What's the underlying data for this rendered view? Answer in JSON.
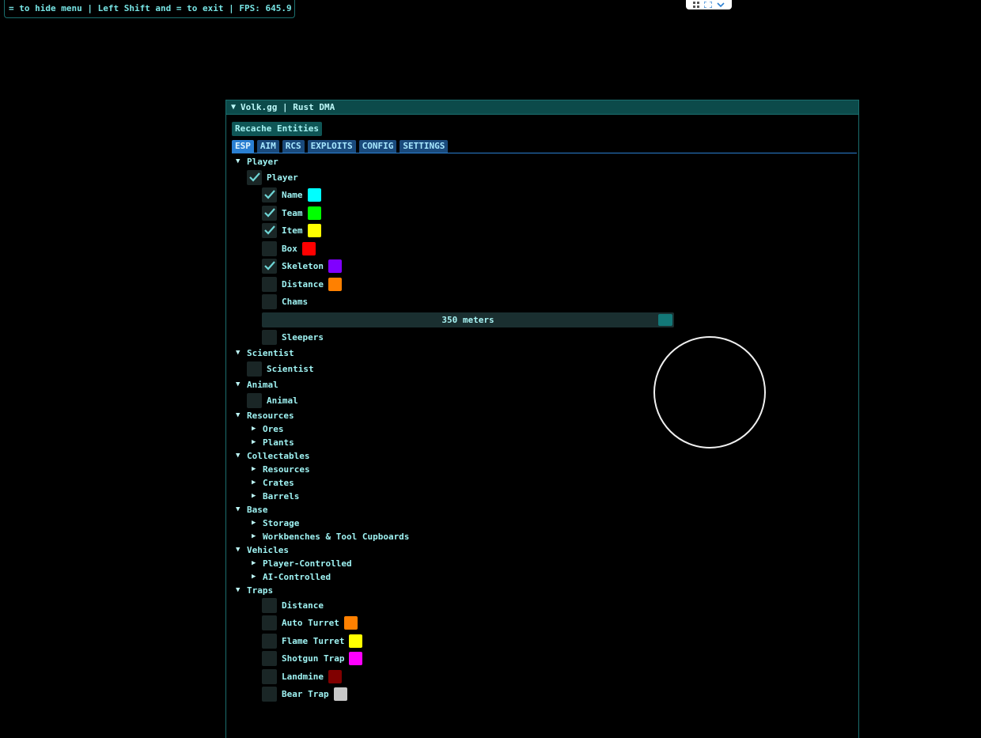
{
  "hint_bar": {
    "text": "= to hide menu | Left Shift and = to exit | FPS: 645.9"
  },
  "window": {
    "title": "Volk.gg | Rust DMA"
  },
  "recache_button": "Recache Entities",
  "tabs": [
    "ESP",
    "AIM",
    "RCS",
    "EXPLOITS",
    "CONFIG",
    "SETTINGS"
  ],
  "active_tab": "ESP",
  "sections": {
    "player": {
      "header": "Player",
      "toggle_label": "Player",
      "toggle_checked": true,
      "options": [
        {
          "label": "Name",
          "checked": true,
          "color": "#00ffff"
        },
        {
          "label": "Team",
          "checked": true,
          "color": "#00ff00"
        },
        {
          "label": "Item",
          "checked": true,
          "color": "#ffff00"
        },
        {
          "label": "Box",
          "checked": false,
          "color": "#ff0000"
        },
        {
          "label": "Skeleton",
          "checked": true,
          "color": "#8000ff"
        },
        {
          "label": "Distance",
          "checked": false,
          "color": "#ff8000"
        },
        {
          "label": "Chams",
          "checked": false
        }
      ],
      "distance_slider": {
        "text": "350 meters"
      },
      "sleepers": {
        "label": "Sleepers",
        "checked": false
      }
    },
    "scientist": {
      "header": "Scientist",
      "toggle_label": "Scientist",
      "toggle_checked": false
    },
    "animal": {
      "header": "Animal",
      "toggle_label": "Animal",
      "toggle_checked": false
    },
    "resources": {
      "header": "Resources",
      "items": [
        "Ores",
        "Plants"
      ]
    },
    "collectables": {
      "header": "Collectables",
      "items": [
        "Resources",
        "Crates",
        "Barrels"
      ]
    },
    "base": {
      "header": "Base",
      "items": [
        "Storage",
        "Workbenches & Tool Cupboards"
      ]
    },
    "vehicles": {
      "header": "Vehicles",
      "items": [
        "Player-Controlled",
        "AI-Controlled"
      ]
    },
    "traps": {
      "header": "Traps",
      "options": [
        {
          "label": "Distance",
          "checked": false
        },
        {
          "label": "Auto Turret",
          "checked": false,
          "color": "#ff8000"
        },
        {
          "label": "Flame Turret",
          "checked": false,
          "color": "#ffff00"
        },
        {
          "label": "Shotgun Trap",
          "checked": false,
          "color": "#ff00ff"
        },
        {
          "label": "Landmine",
          "checked": false,
          "color": "#800000"
        },
        {
          "label": "Bear Trap",
          "checked": false,
          "color": "#c8c8c8"
        }
      ]
    }
  },
  "colors": {
    "accent": "#1b6e6e",
    "tab_active": "#2a7fd2",
    "tab": "#1a4a7c"
  }
}
